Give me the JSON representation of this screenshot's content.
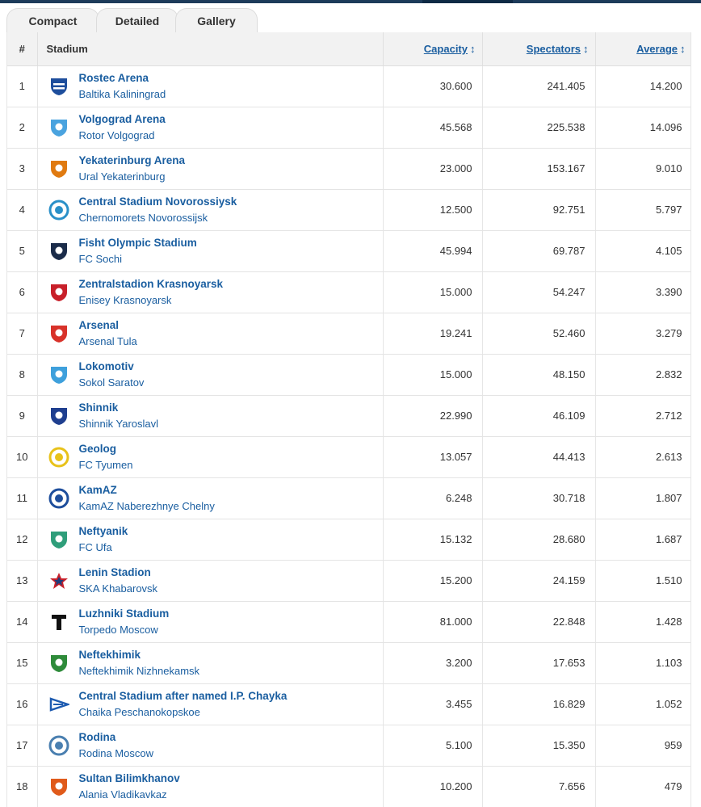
{
  "tabs": [
    {
      "label": "Compact",
      "active": true
    },
    {
      "label": "Detailed",
      "active": false
    },
    {
      "label": "Gallery",
      "active": false
    }
  ],
  "columns": {
    "rank": "#",
    "stadium": "Stadium",
    "capacity": "Capacity",
    "spectators": "Spectators",
    "average": "Average"
  },
  "sort_glyph": "↕",
  "rows": [
    {
      "rank": "1",
      "stadium": "Rostec Arena",
      "club": "Baltika Kaliningrad",
      "capacity": "30.600",
      "spectators": "241.405",
      "average": "14.200",
      "logo_color": "#1e4e9c",
      "logo_shape": "shield-stripes-icon"
    },
    {
      "rank": "2",
      "stadium": "Volgograd Arena",
      "club": "Rotor Volgograd",
      "capacity": "45.568",
      "spectators": "225.538",
      "average": "14.096",
      "logo_color": "#4aa3df",
      "logo_shape": "shield-icon"
    },
    {
      "rank": "3",
      "stadium": "Yekaterinburg Arena",
      "club": "Ural Yekaterinburg",
      "capacity": "23.000",
      "spectators": "153.167",
      "average": "9.010",
      "logo_color": "#e07a10",
      "logo_shape": "shield-icon"
    },
    {
      "rank": "4",
      "stadium": "Central Stadium Novorossiysk",
      "club": "Chernomorets Novorossijsk",
      "capacity": "12.500",
      "spectators": "92.751",
      "average": "5.797",
      "logo_color": "#2a90c8",
      "logo_shape": "circle-icon"
    },
    {
      "rank": "5",
      "stadium": "Fisht Olympic Stadium",
      "club": "FC Sochi",
      "capacity": "45.994",
      "spectators": "69.787",
      "average": "4.105",
      "logo_color": "#1b2c4a",
      "logo_shape": "shield-icon"
    },
    {
      "rank": "6",
      "stadium": "Zentralstadion Krasnoyarsk",
      "club": "Enisey Krasnoyarsk",
      "capacity": "15.000",
      "spectators": "54.247",
      "average": "3.390",
      "logo_color": "#c8202a",
      "logo_shape": "shield-icon"
    },
    {
      "rank": "7",
      "stadium": "Arsenal",
      "club": "Arsenal Tula",
      "capacity": "19.241",
      "spectators": "52.460",
      "average": "3.279",
      "logo_color": "#d8322a",
      "logo_shape": "shield-icon"
    },
    {
      "rank": "8",
      "stadium": "Lokomotiv",
      "club": "Sokol Saratov",
      "capacity": "15.000",
      "spectators": "48.150",
      "average": "2.832",
      "logo_color": "#3ea0dc",
      "logo_shape": "shield-icon"
    },
    {
      "rank": "9",
      "stadium": "Shinnik",
      "club": "Shinnik Yaroslavl",
      "capacity": "22.990",
      "spectators": "46.109",
      "average": "2.712",
      "logo_color": "#1f3f8f",
      "logo_shape": "shield-icon"
    },
    {
      "rank": "10",
      "stadium": "Geolog",
      "club": "FC Tyumen",
      "capacity": "13.057",
      "spectators": "44.413",
      "average": "2.613",
      "logo_color": "#e8c21a",
      "logo_shape": "circle-icon"
    },
    {
      "rank": "11",
      "stadium": "KamAZ",
      "club": "KamAZ Naberezhnye Chelny",
      "capacity": "6.248",
      "spectators": "30.718",
      "average": "1.807",
      "logo_color": "#1e4e9c",
      "logo_shape": "circle-icon"
    },
    {
      "rank": "12",
      "stadium": "Neftyanik",
      "club": "FC Ufa",
      "capacity": "15.132",
      "spectators": "28.680",
      "average": "1.687",
      "logo_color": "#2f9e7a",
      "logo_shape": "shield-icon"
    },
    {
      "rank": "13",
      "stadium": "Lenin Stadion",
      "club": "SKA Khabarovsk",
      "capacity": "15.200",
      "spectators": "24.159",
      "average": "1.510",
      "logo_color": "#c8202a",
      "logo_shape": "star-icon"
    },
    {
      "rank": "14",
      "stadium": "Luzhniki Stadium",
      "club": "Torpedo Moscow",
      "capacity": "81.000",
      "spectators": "22.848",
      "average": "1.428",
      "logo_color": "#111111",
      "logo_shape": "letter-t-icon"
    },
    {
      "rank": "15",
      "stadium": "Neftekhimik",
      "club": "Neftekhimik Nizhnekamsk",
      "capacity": "3.200",
      "spectators": "17.653",
      "average": "1.103",
      "logo_color": "#2e8b3a",
      "logo_shape": "shield-icon"
    },
    {
      "rank": "16",
      "stadium": "Central Stadium after named I.P. Chayka",
      "club": "Chaika Peschanokopskoe",
      "capacity": "3.455",
      "spectators": "16.829",
      "average": "1.052",
      "logo_color": "#1e5bb0",
      "logo_shape": "pennant-icon"
    },
    {
      "rank": "17",
      "stadium": "Rodina",
      "club": "Rodina Moscow",
      "capacity": "5.100",
      "spectators": "15.350",
      "average": "959",
      "logo_color": "#4a7fb0",
      "logo_shape": "circle-icon"
    },
    {
      "rank": "18",
      "stadium": "Sultan Bilimkhanov",
      "club": "Alania Vladikavkaz",
      "capacity": "10.200",
      "spectators": "7.656",
      "average": "479",
      "logo_color": "#e05a1a",
      "logo_shape": "shield-icon"
    }
  ]
}
